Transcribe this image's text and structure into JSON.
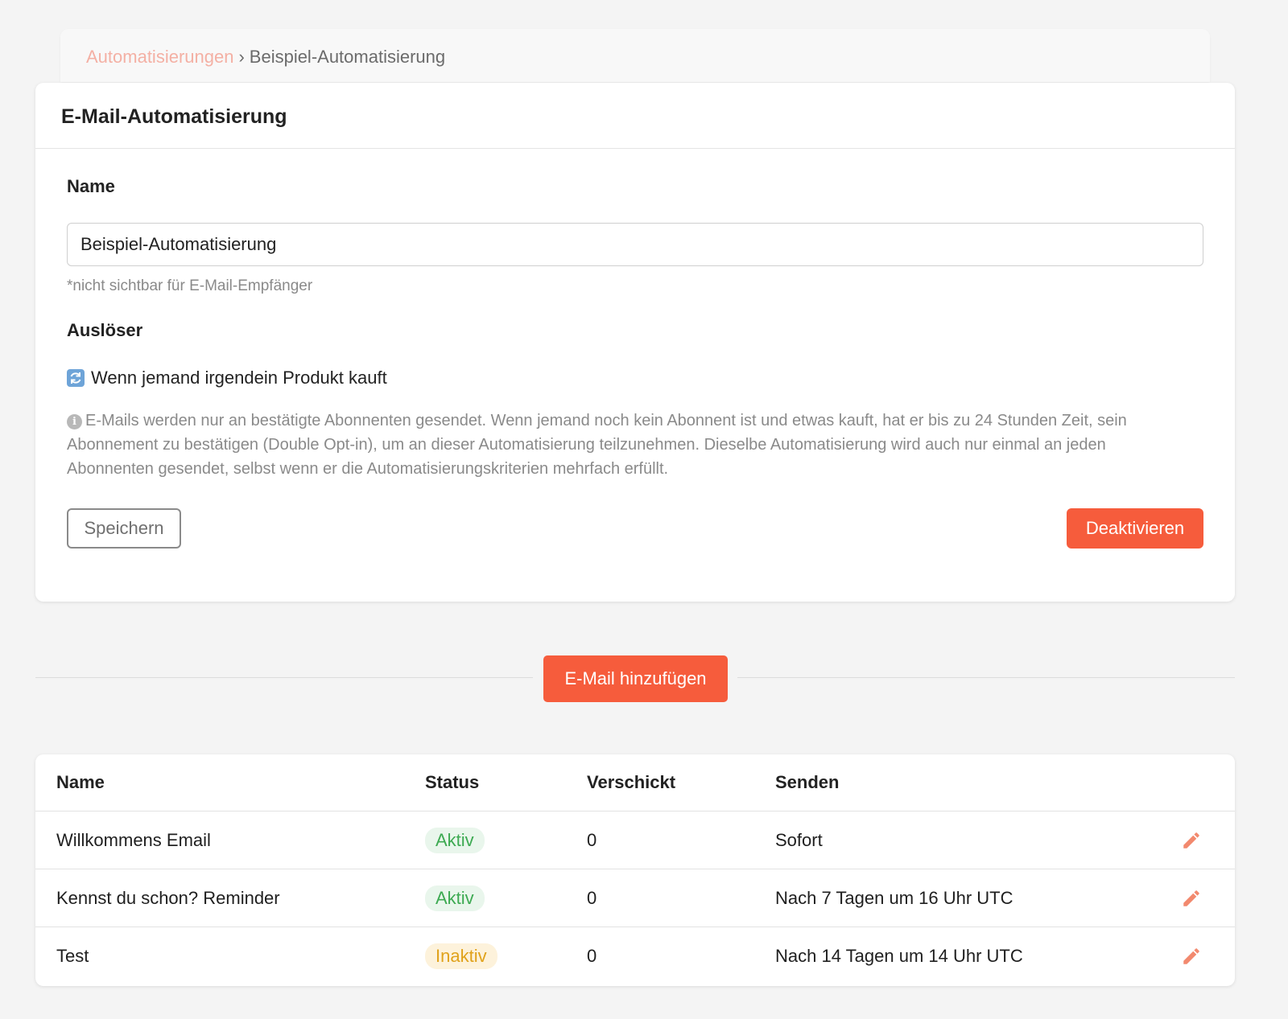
{
  "breadcrumb": {
    "parent": "Automatisierungen",
    "separator": "›",
    "current": "Beispiel-Automatisierung"
  },
  "card": {
    "title": "E-Mail-Automatisierung",
    "name_label": "Name",
    "name_value": "Beispiel-Automatisierung",
    "name_hint": "*nicht sichtbar für E-Mail-Empfänger",
    "trigger_label": "Auslöser",
    "trigger_icon": "refresh-icon",
    "trigger_text": "Wenn jemand irgendein Produkt kauft",
    "info_icon": "info-icon",
    "info_text": "E-Mails werden nur an bestätigte Abonnenten gesendet. Wenn jemand noch kein Abonnent ist und etwas kauft, hat er bis zu 24 Stunden Zeit, sein Abonnement zu bestätigen (Double Opt-in), um an dieser Automatisierung teilzunehmen. Dieselbe Automatisierung wird auch nur einmal an jeden Abonnenten gesendet, selbst wenn er die Automatisierungskriterien mehrfach erfüllt.",
    "save_label": "Speichern",
    "deactivate_label": "Deaktivieren"
  },
  "add_email_label": "E-Mail hinzufügen",
  "table": {
    "headers": {
      "name": "Name",
      "status": "Status",
      "sent": "Verschickt",
      "send": "Senden"
    },
    "rows": [
      {
        "name": "Willkommens Email",
        "status": "Aktiv",
        "sent": "0",
        "send": "Sofort"
      },
      {
        "name": "Kennst du schon? Reminder",
        "status": "Aktiv",
        "sent": "0",
        "send": "Nach 7 Tagen um 16 Uhr UTC"
      },
      {
        "name": "Test",
        "status": "Inaktiv",
        "sent": "0",
        "send": "Nach 14 Tagen um 14 Uhr UTC"
      }
    ]
  },
  "colors": {
    "accent": "#f65c3c",
    "active_text": "#3daa52",
    "active_bg": "#e9f6ec",
    "inactive_text": "#e0a21b",
    "inactive_bg": "#fdf2db",
    "edit_icon": "#f2896e"
  }
}
